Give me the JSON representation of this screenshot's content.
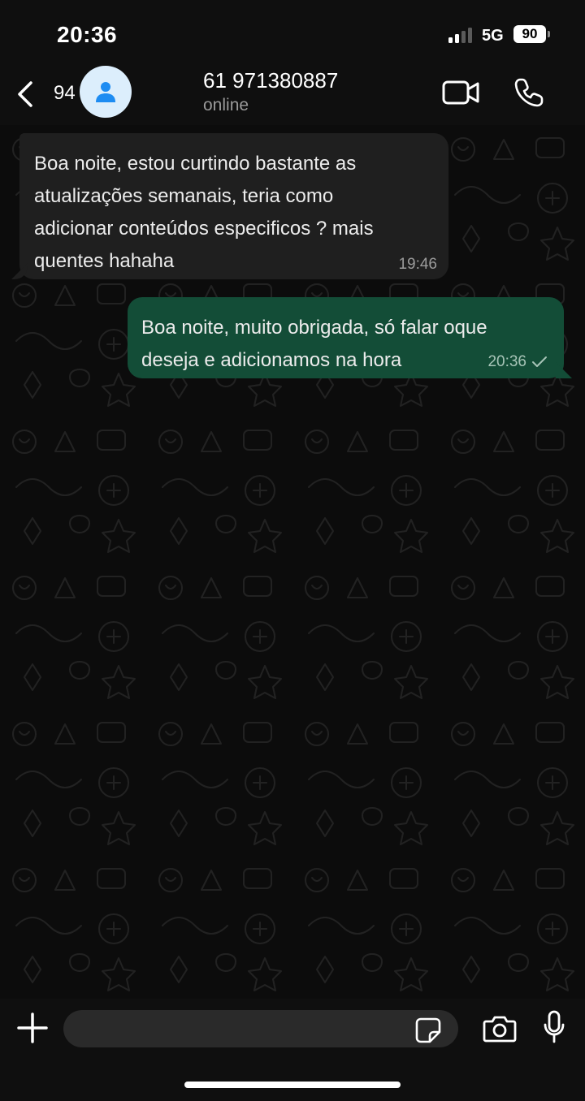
{
  "status_bar": {
    "time": "20:36",
    "network": "5G",
    "battery": "90",
    "signal_bars": 2,
    "signal_total": 4
  },
  "header": {
    "back_icon": "chevron-left-icon",
    "unread_count": "94",
    "avatar_icon": "person-icon",
    "contact_name": "61 971380887",
    "contact_status": "online",
    "video_icon": "video-camera-icon",
    "call_icon": "phone-icon"
  },
  "messages": [
    {
      "direction": "incoming",
      "text": "Boa noite, estou curtindo bastante as\natualizações semanais, teria como\nadicionar conteúdos especificos ? mais\nquentes hahaha",
      "time": "19:46"
    },
    {
      "direction": "outgoing",
      "text": "Boa noite, muito obrigada, só falar oque\ndeseja e adicionamos na hora",
      "time": "20:36",
      "status_icon": "single-check-icon"
    }
  ],
  "composer": {
    "attach_icon": "plus-icon",
    "input_value": "",
    "input_placeholder": "",
    "sticker_icon": "sticker-icon",
    "camera_icon": "camera-icon",
    "mic_icon": "microphone-icon"
  },
  "colors": {
    "background": "#0b0b0b",
    "incoming_bubble": "#1f1f1f",
    "outgoing_bubble": "#134d37",
    "avatar_bg": "#dceefc",
    "avatar_icon": "#1d8cf2"
  }
}
